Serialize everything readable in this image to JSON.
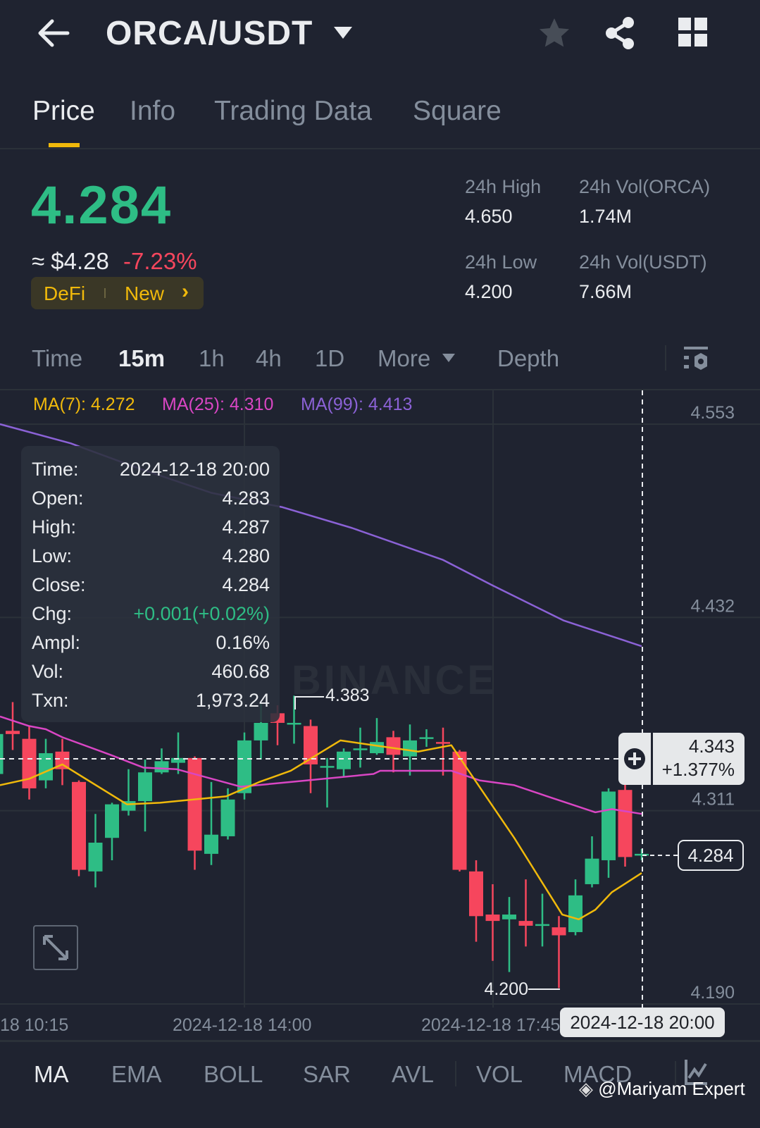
{
  "header": {
    "title": "ORCA/USDT",
    "icons": [
      "back-arrow-icon",
      "dropdown-caret-icon",
      "star-icon",
      "share-icon",
      "grid-icon"
    ]
  },
  "tabs": [
    {
      "label": "Price",
      "active": true
    },
    {
      "label": "Info"
    },
    {
      "label": "Trading Data"
    },
    {
      "label": "Square"
    }
  ],
  "price": {
    "last": "4.284",
    "usd": "≈ $4.28",
    "change": "-7.23%",
    "tags": [
      "DeFi",
      "New"
    ],
    "tag_chevron": "›"
  },
  "stats": {
    "high_label": "24h High",
    "high": "4.650",
    "low_label": "24h Low",
    "low": "4.200",
    "vol_base_label": "24h Vol(ORCA)",
    "vol_base": "1.74M",
    "vol_quote_label": "24h Vol(USDT)",
    "vol_quote": "7.66M"
  },
  "timeframes": {
    "items": [
      "Time",
      "15m",
      "1h",
      "4h",
      "1D",
      "More",
      "Depth"
    ],
    "active": "15m"
  },
  "ma_legend": {
    "ma7": "MA(7): 4.272",
    "ma25": "MA(25): 4.310",
    "ma99": "MA(99): 4.413"
  },
  "tooltip": [
    {
      "label": "Time:",
      "value": "2024-12-18 20:00"
    },
    {
      "label": "Open:",
      "value": "4.283"
    },
    {
      "label": "High:",
      "value": "4.287"
    },
    {
      "label": "Low:",
      "value": "4.280"
    },
    {
      "label": "Close:",
      "value": "4.284"
    },
    {
      "label": "Chg:",
      "value": "+0.001(+0.02%)",
      "positive": true
    },
    {
      "label": "Ampl:",
      "value": "0.16%"
    },
    {
      "label": "Vol:",
      "value": "460.68"
    },
    {
      "label": "Txn:",
      "value": "1,973.24"
    }
  ],
  "crosshair": {
    "price": "4.343",
    "pct": "+1.377%",
    "time": "2024-12-18 20:00"
  },
  "current_price_tag": "4.284",
  "watermark": "BINANCE",
  "indicators": {
    "items": [
      "MA",
      "EMA",
      "BOLL",
      "SAR",
      "AVL",
      "VOL",
      "MACD"
    ],
    "active": "MA"
  },
  "credit": "@Mariyam Expert",
  "colors": {
    "up": "#2ebd85",
    "down": "#f6465d",
    "ma7": "#f0b90b",
    "ma25": "#d946c4",
    "ma99": "#8b62d6",
    "accent": "#f0b90b"
  },
  "chart_data": {
    "type": "candlestick",
    "interval": "15m",
    "y_ticks": [
      "4.553",
      "4.432",
      "4.311",
      "4.190"
    ],
    "ylim": [
      4.19,
      4.553
    ],
    "x_ticks": [
      "18 10:15",
      "2024-12-18 14:00",
      "2024-12-18 17:45"
    ],
    "high_marker": "4.383",
    "low_marker": "4.200",
    "candles": [
      [
        4.334,
        4.362,
        4.33,
        4.359
      ],
      [
        4.361,
        4.379,
        4.349,
        4.359
      ],
      [
        4.356,
        4.364,
        4.318,
        4.325
      ],
      [
        4.33,
        4.356,
        4.325,
        4.347
      ],
      [
        4.348,
        4.356,
        4.327,
        4.337
      ],
      [
        4.329,
        4.33,
        4.27,
        4.274
      ],
      [
        4.273,
        4.309,
        4.263,
        4.291
      ],
      [
        4.294,
        4.316,
        4.28,
        4.315
      ],
      [
        4.311,
        4.337,
        4.308,
        4.317
      ],
      [
        4.317,
        4.343,
        4.298,
        4.335
      ],
      [
        4.335,
        4.35,
        4.334,
        4.342
      ],
      [
        4.341,
        4.36,
        4.334,
        4.344
      ],
      [
        4.344,
        4.345,
        4.274,
        4.286
      ],
      [
        4.284,
        4.329,
        4.277,
        4.296
      ],
      [
        4.295,
        4.325,
        4.293,
        4.318
      ],
      [
        4.322,
        4.36,
        4.318,
        4.355
      ],
      [
        4.355,
        4.378,
        4.343,
        4.366
      ],
      [
        4.372,
        4.377,
        4.352,
        4.366
      ],
      [
        4.365,
        4.383,
        4.353,
        4.366
      ],
      [
        4.364,
        4.368,
        4.322,
        4.34
      ],
      [
        4.338,
        4.344,
        4.313,
        4.339
      ],
      [
        4.337,
        4.35,
        4.332,
        4.348
      ],
      [
        4.349,
        4.363,
        4.338,
        4.35
      ],
      [
        4.347,
        4.369,
        4.346,
        4.354
      ],
      [
        4.357,
        4.361,
        4.335,
        4.346
      ],
      [
        4.345,
        4.365,
        4.333,
        4.355
      ],
      [
        4.356,
        4.362,
        4.351,
        4.357
      ],
      [
        4.354,
        4.363,
        4.333,
        4.353
      ],
      [
        4.348,
        4.349,
        4.273,
        4.274
      ],
      [
        4.273,
        4.28,
        4.229,
        4.245
      ],
      [
        4.246,
        4.265,
        4.217,
        4.242
      ],
      [
        4.243,
        4.257,
        4.21,
        4.246
      ],
      [
        4.242,
        4.268,
        4.226,
        4.239
      ],
      [
        4.239,
        4.259,
        4.226,
        4.24
      ],
      [
        4.238,
        4.245,
        4.2,
        4.233
      ],
      [
        4.235,
        4.268,
        4.233,
        4.258
      ],
      [
        4.265,
        4.295,
        4.263,
        4.281
      ],
      [
        4.28,
        4.325,
        4.269,
        4.323
      ],
      [
        4.324,
        4.328,
        4.276,
        4.282
      ],
      [
        4.283,
        4.287,
        4.28,
        4.284
      ]
    ],
    "ma7": [
      [
        -0.77,
        4.327
      ],
      [
        1,
        4.331
      ],
      [
        3,
        4.34
      ],
      [
        6.9,
        4.315
      ],
      [
        8.9,
        4.316
      ],
      [
        12.9,
        4.32
      ],
      [
        14.9,
        4.329
      ],
      [
        16.8,
        4.336
      ],
      [
        19.8,
        4.355
      ],
      [
        21.8,
        4.352
      ],
      [
        24.5,
        4.348
      ],
      [
        26.5,
        4.352
      ],
      [
        28.2,
        4.326
      ],
      [
        30.3,
        4.294
      ],
      [
        33.2,
        4.246
      ],
      [
        34.2,
        4.243
      ],
      [
        35.2,
        4.249
      ],
      [
        36.2,
        4.26
      ],
      [
        38,
        4.272
      ]
    ],
    "ma25": [
      [
        -0.77,
        4.37
      ],
      [
        1,
        4.364
      ],
      [
        2,
        4.362
      ],
      [
        3,
        4.357
      ],
      [
        5.9,
        4.346
      ],
      [
        7.9,
        4.338
      ],
      [
        9.9,
        4.337
      ],
      [
        13.8,
        4.326
      ],
      [
        16.8,
        4.329
      ],
      [
        21.8,
        4.334
      ],
      [
        22.2,
        4.336
      ],
      [
        26.5,
        4.336
      ],
      [
        28.2,
        4.33
      ],
      [
        30.3,
        4.327
      ],
      [
        32.3,
        4.32
      ],
      [
        35.2,
        4.31
      ],
      [
        36.2,
        4.312
      ],
      [
        38,
        4.309
      ]
    ],
    "ma99": [
      [
        -0.77,
        4.553
      ],
      [
        3.5,
        4.541
      ],
      [
        7.7,
        4.525
      ],
      [
        12,
        4.51
      ],
      [
        16.3,
        4.501
      ],
      [
        20.5,
        4.488
      ],
      [
        26,
        4.468
      ],
      [
        29,
        4.452
      ],
      [
        33.3,
        4.43
      ],
      [
        38,
        4.414
      ]
    ]
  }
}
